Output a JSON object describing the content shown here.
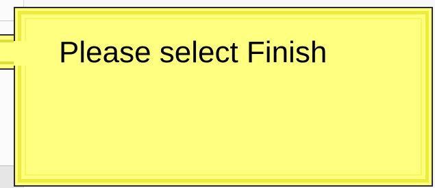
{
  "callout": {
    "message": "Please select Finish",
    "background_color": "#ffff80",
    "border_color": "#2a2a2a",
    "inner_border_color": "#ecec3c"
  }
}
